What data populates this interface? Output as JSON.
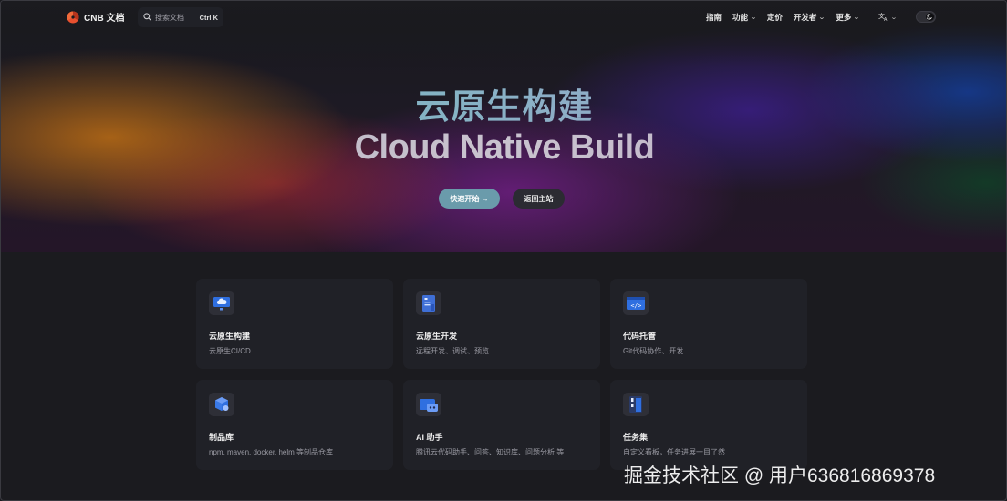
{
  "colors": {
    "accent": "#6a9bab",
    "background": "#1b1b1f",
    "card_background": "#202127",
    "logo_red": "#e8502f"
  },
  "nav": {
    "logo_text": "CNB 文档",
    "search_placeholder": "搜索文档",
    "search_shortcut": "Ctrl K",
    "links": [
      {
        "label": "指南",
        "dropdown": false
      },
      {
        "label": "功能",
        "dropdown": true
      },
      {
        "label": "定价",
        "dropdown": false
      },
      {
        "label": "开发者",
        "dropdown": true
      },
      {
        "label": "更多",
        "dropdown": true
      }
    ],
    "language_icon": "translate-icon",
    "theme_toggle_icon": "moon-icon"
  },
  "hero": {
    "title_cn": "云原生构建",
    "title_en": "Cloud Native Build",
    "primary_button": "快速开始 →",
    "secondary_button": "返回主站"
  },
  "features": [
    {
      "title": "云原生构建",
      "desc": "云原生CI/CD",
      "icon": "cloud-build-icon"
    },
    {
      "title": "云原生开发",
      "desc": "远程开发、调试、预览",
      "icon": "dev-panel-icon"
    },
    {
      "title": "代码托管",
      "desc": "Git代码协作、开发",
      "icon": "code-window-icon"
    },
    {
      "title": "制品库",
      "desc": "npm, maven, docker, helm 等制品仓库",
      "icon": "package-box-icon"
    },
    {
      "title": "AI 助手",
      "desc": "腾讯云代码助手、问答、知识库、问题分析 等",
      "icon": "ai-assistant-icon"
    },
    {
      "title": "任务集",
      "desc": "自定义看板，任务进展一目了然",
      "icon": "task-board-icon"
    }
  ],
  "watermark": "掘金技术社区 @ 用户636816869378"
}
